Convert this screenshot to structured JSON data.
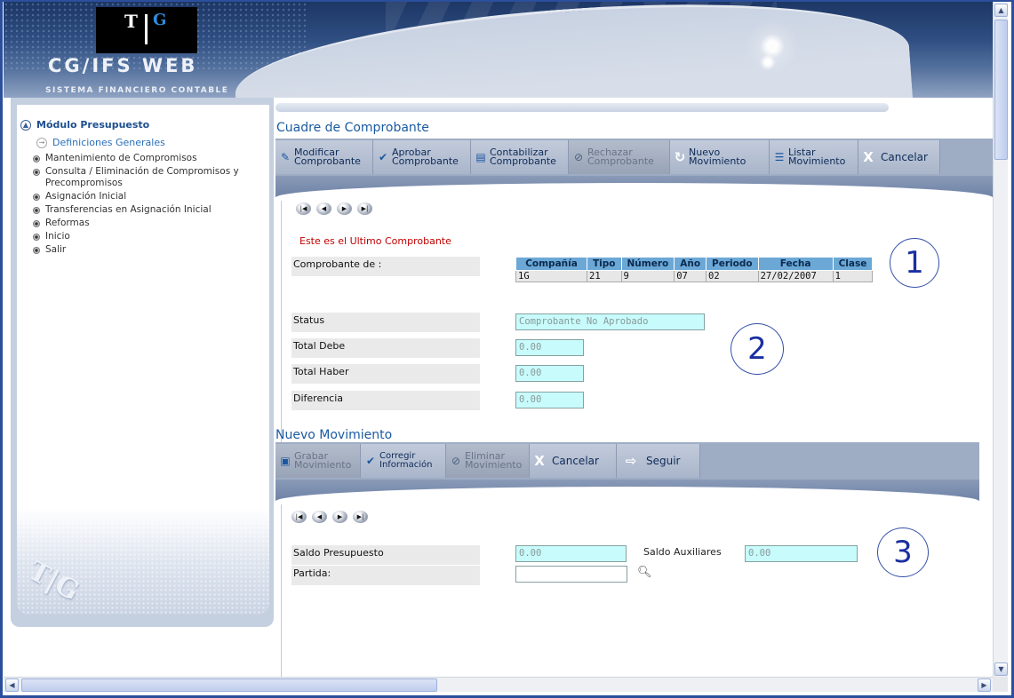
{
  "header": {
    "logo_t": "T",
    "logo_g": "G",
    "app_title": "CG/IFS WEB",
    "app_subtitle": "SISTEMA FINANCIERO CONTABLE"
  },
  "sidebar": {
    "module": "Módulo Presupuesto",
    "definitions": "Definiciones Generales",
    "items": [
      {
        "label": "Mantenimiento de Compromisos"
      },
      {
        "label": "Consulta / Eliminación de Compromisos y Precompromisos"
      },
      {
        "label": "Asignación Inicial"
      },
      {
        "label": "Transferencias en Asignación Inicial"
      },
      {
        "label": "Reformas"
      },
      {
        "label": "Inicio"
      },
      {
        "label": "Salir"
      }
    ],
    "watermark": "T|G"
  },
  "cuadre": {
    "title": "Cuadre de Comprobante",
    "buttons": [
      {
        "line1": "Modificar",
        "line2": "Comprobante",
        "icon": "edit-doc-icon"
      },
      {
        "line1": "Aprobar",
        "line2": "Comprobante",
        "icon": "approve-doc-icon"
      },
      {
        "line1": "Contabilizar",
        "line2": "Comprobante",
        "icon": "ledger-icon"
      },
      {
        "line1": "Rechazar",
        "line2": "Comprobante",
        "icon": "reject-icon",
        "disabled": true
      },
      {
        "line1": "Nuevo",
        "line2": "Movimiento",
        "icon": "refresh-icon"
      },
      {
        "line1": "Listar",
        "line2": "Movimiento",
        "icon": "list-icon"
      },
      {
        "line1": "Cancelar",
        "line2": "",
        "icon": "x-icon"
      }
    ],
    "message": "Este es el Ultimo Comprobante",
    "comprobante_label": "Comprobante de :",
    "table": {
      "headers": [
        "Compañía",
        "Tipo",
        "Número",
        "Año",
        "Periodo",
        "Fecha",
        "Clase"
      ],
      "row": [
        "1G",
        "21",
        "9",
        "07",
        "02",
        "27/02/2007",
        "1"
      ]
    },
    "status_label": "Status",
    "status_value": "Comprobante No Aprobado",
    "total_debe_label": "Total Debe",
    "total_debe_value": "0.00",
    "total_haber_label": "Total Haber",
    "total_haber_value": "0.00",
    "diferencia_label": "Diferencia",
    "diferencia_value": "0.00"
  },
  "nuevo": {
    "title": "Nuevo Movimiento",
    "buttons": [
      {
        "line1": "Grabar",
        "line2": "Movimiento",
        "icon": "save-icon",
        "disabled": true
      },
      {
        "line1": "Corregir",
        "line2": "Información",
        "icon": "check-icon"
      },
      {
        "line1": "Eliminar",
        "line2": "Movimiento",
        "icon": "delete-icon",
        "disabled": true
      },
      {
        "line1": "Cancelar",
        "line2": "",
        "icon": "x-icon"
      },
      {
        "line1": "Seguir",
        "line2": "",
        "icon": "arrow-right-icon"
      }
    ],
    "saldo_presupuesto_label": "Saldo Presupuesto",
    "saldo_presupuesto_value": "0.00",
    "saldo_auxiliares_label": "Saldo Auxiliares",
    "saldo_auxiliares_value": "0.00",
    "partida_label": "Partida:",
    "partida_value": ""
  },
  "annotations": [
    "1",
    "2",
    "3"
  ]
}
